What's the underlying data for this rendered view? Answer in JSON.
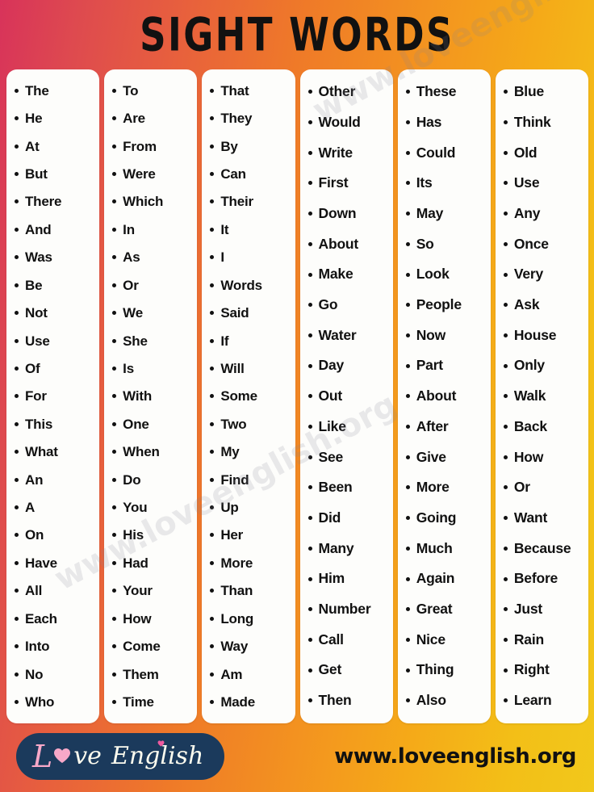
{
  "header": {
    "title": "SIGHT WORDS"
  },
  "theme": {
    "gradient_start": "#d8335a",
    "gradient_mid": "#ef7a28",
    "gradient_end": "#f1c81b",
    "card_background": "#fdfdfb",
    "text_color": "#111111",
    "logo_badge_color": "#1b3a5c",
    "logo_accent_color": "#f7a8c8",
    "logo_text_color": "#fdfcef"
  },
  "columns": [
    {
      "id": "column-1",
      "words": [
        "The",
        "He",
        "At",
        "But",
        "There",
        "And",
        "Was",
        "Be",
        "Not",
        "Use",
        "Of",
        "For",
        "This",
        "What",
        "An",
        "A",
        "On",
        "Have",
        "All",
        "Each",
        "Into",
        "No",
        "Who"
      ]
    },
    {
      "id": "column-2",
      "words": [
        "To",
        "Are",
        "From",
        "Were",
        "Which",
        "In",
        "As",
        "Or",
        "We",
        "She",
        "Is",
        "With",
        "One",
        "When",
        "Do",
        "You",
        "His",
        "Had",
        "Your",
        "How",
        "Come",
        "Them",
        "Time"
      ]
    },
    {
      "id": "column-3",
      "words": [
        "That",
        "They",
        "By",
        "Can",
        "Their",
        "It",
        "I",
        "Words",
        "Said",
        "If",
        "Will",
        "Some",
        "Two",
        "My",
        "Find",
        "Up",
        "Her",
        "More",
        "Than",
        "Long",
        "Way",
        "Am",
        "Made"
      ]
    },
    {
      "id": "column-4",
      "words": [
        "Other",
        "Would",
        "Write",
        "First",
        "Down",
        "About",
        "Make",
        "Go",
        "Water",
        "Day",
        "Out",
        "Like",
        "See",
        "Been",
        "Did",
        "Many",
        "Him",
        "Number",
        "Call",
        "Get",
        "Then"
      ]
    },
    {
      "id": "column-5",
      "words": [
        "These",
        "Has",
        "Could",
        "Its",
        "May",
        "So",
        "Look",
        "People",
        "Now",
        "Part",
        "About",
        "After",
        "Give",
        "More",
        "Going",
        "Much",
        "Again",
        "Great",
        "Nice",
        "Thing",
        "Also"
      ]
    },
    {
      "id": "column-6",
      "words": [
        "Blue",
        "Think",
        "Old",
        "Use",
        "Any",
        "Once",
        "Very",
        "Ask",
        "House",
        "Only",
        "Walk",
        "Back",
        "How",
        "Or",
        "Want",
        "Because",
        "Before",
        "Just",
        "Rain",
        "Right",
        "Learn"
      ]
    }
  ],
  "footer": {
    "logo": {
      "letter": "L",
      "heart_icon": "heart-icon",
      "word_tail": "ve",
      "second_word": "English"
    },
    "url": "www.loveenglish.org"
  },
  "watermark": {
    "text_a": "www.loveenglish.org",
    "text_b": "www.loveenglish.org"
  }
}
